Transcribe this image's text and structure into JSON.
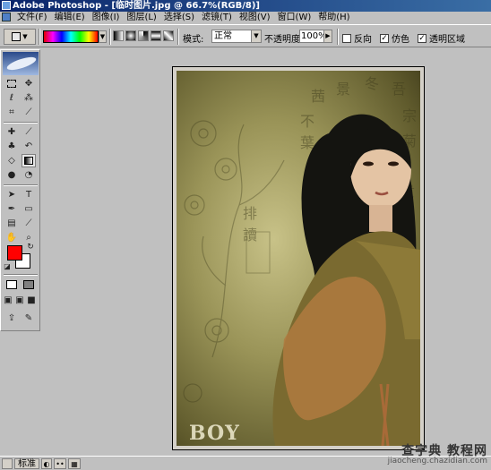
{
  "window": {
    "title": "Adobe Photoshop - [临时图片.jpg @ 66.7%(RGB/8)]"
  },
  "menu": {
    "items": [
      "文件(F)",
      "编辑(E)",
      "图像(I)",
      "图层(L)",
      "选择(S)",
      "滤镜(T)",
      "视图(V)",
      "窗口(W)",
      "帮助(H)"
    ]
  },
  "options": {
    "mode_label": "模式:",
    "mode_value": "正常",
    "opacity_label": "不透明度:",
    "opacity_value": "100%",
    "reverse_label": "反向",
    "dither_label": "仿色",
    "transparency_label": "透明区域",
    "reverse_checked": false,
    "dither_checked": true,
    "transparency_checked": true,
    "gradient_colors": [
      "#e00000",
      "#ff00ff",
      "#0000ff",
      "#00ffff",
      "#00ff00",
      "#ffff00",
      "#ff0000"
    ]
  },
  "toolbox": {
    "foreground_color": "#ff0000",
    "background_color": "#ffffff",
    "active_tool": "gradient-tool"
  },
  "document": {
    "file_name": "临时图片.jpg",
    "zoom": "66.7%",
    "color_mode": "RGB/8",
    "photo_brand": "BOY"
  },
  "statusbar": {
    "standard_label": "标准"
  },
  "watermark": {
    "title": "查字典 教程网",
    "url": "jiaocheng.chazidian.com"
  }
}
